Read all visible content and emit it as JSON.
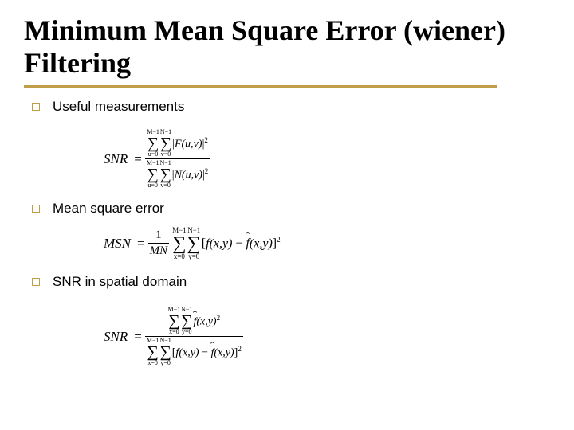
{
  "title": "Minimum Mean Square Error (wiener) Filtering",
  "items": {
    "a": "Useful measurements",
    "b": "Mean square error",
    "c": "SNR in spatial domain"
  },
  "eq1": {
    "lhs": "SNR",
    "num_s1_up": "M−1",
    "num_s1_lo": "u=0",
    "num_s2_up": "N−1",
    "num_s2_lo": "v=0",
    "num_term_l": "|",
    "num_term_f": "F",
    "num_term_args": "(u,v)",
    "num_term_r": "|",
    "num_term_sup": "2",
    "den_s1_up": "M−1",
    "den_s1_lo": "u=0",
    "den_s2_up": "N−1",
    "den_s2_lo": "v=0",
    "den_term_l": "|",
    "den_term_f": "N",
    "den_term_args": "(u,v)",
    "den_term_r": "|",
    "den_term_sup": "2"
  },
  "eq2": {
    "lhs": "MSN",
    "frac_num": "1",
    "frac_den": "MN",
    "s1_up": "M−1",
    "s1_lo": "x=0",
    "s2_up": "N−1",
    "s2_lo": "y=0",
    "lbr": "[",
    "f": "f",
    "args": "(x,y)",
    "minus": " − ",
    "fhat": "f",
    "args2": "(x,y)",
    "rbr": "]",
    "sup": "2"
  },
  "eq3": {
    "lhs": "SNR",
    "num_s1_up": "M−1",
    "num_s1_lo": "x=0",
    "num_s2_up": "N−1",
    "num_s2_lo": "y=0",
    "num_fhat": "f",
    "num_args": "(x,y)",
    "num_sup": "2",
    "den_s1_up": "M−1",
    "den_s1_lo": "x=0",
    "den_s2_up": "N−1",
    "den_s2_lo": "y=0",
    "den_lbr": "[",
    "den_f": "f",
    "den_args": "(x,y)",
    "den_minus": " − ",
    "den_fhat": "f",
    "den_args2": "(x,y)",
    "den_rbr": "]",
    "den_sup": "2"
  }
}
